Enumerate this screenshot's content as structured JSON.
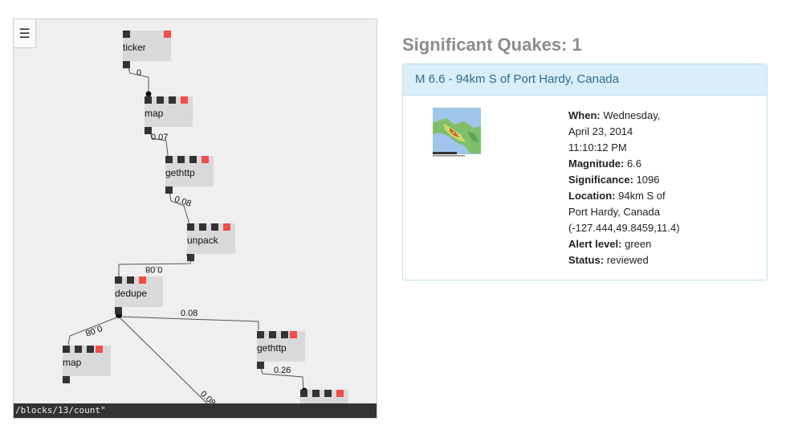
{
  "editor": {
    "menu_icon": "hamburger-menu-icon",
    "blocks": [
      {
        "id": "ticker",
        "label": "ticker"
      },
      {
        "id": "map1",
        "label": "map"
      },
      {
        "id": "gethttp1",
        "label": "gethttp"
      },
      {
        "id": "unpack",
        "label": "unpack"
      },
      {
        "id": "dedupe",
        "label": "dedupe"
      },
      {
        "id": "map2",
        "label": "map"
      },
      {
        "id": "gethttp2",
        "label": "gethttp"
      }
    ],
    "wire_labels": [
      "0",
      "0.07",
      "0.08",
      "0.08",
      "0.08",
      "0.08",
      "0.26",
      "0.08"
    ],
    "status_text": "/blocks/13/count\""
  },
  "quakes": {
    "title": "Significant Quakes: 1",
    "item": {
      "heading": "M 6.6 - 94km S of Port Hardy, Canada",
      "when_label": "When:",
      "when_line1": "Wednesday,",
      "when_line2": "April 23, 2014",
      "when_line3": "11:10:12 PM",
      "magnitude_label": "Magnitude:",
      "magnitude": "6.6",
      "significance_label": "Significance:",
      "significance": "1096",
      "location_label": "Location:",
      "location_line1": "94km S of",
      "location_line2": "Port Hardy, Canada",
      "location_line3": "(-127.444,49.8459,11.4)",
      "alert_label": "Alert level:",
      "alert": "green",
      "status_label": "Status:",
      "status": "reviewed"
    }
  },
  "colors": {
    "route_port": "#f04d4d",
    "panel_heading_bg": "#d9eef8",
    "panel_heading_text": "#2f6c8f",
    "title_text": "#8c8c8c"
  }
}
